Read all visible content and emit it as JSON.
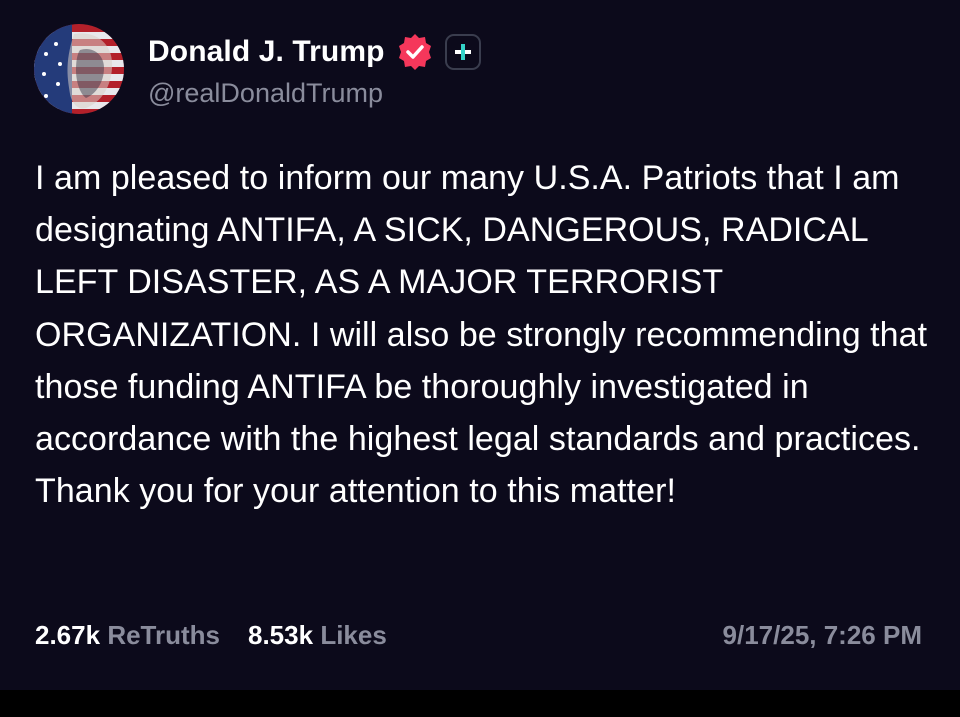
{
  "author": {
    "display_name": "Donald J. Trump",
    "handle": "@realDonaldTrump",
    "verified_icon": "verified-badge-icon",
    "plus_icon": "truth-plus-icon",
    "verified_color": "#f5375b",
    "plus_color": "#34d3c8"
  },
  "post": {
    "text": "I am pleased to inform our many U.S.A. Patriots that I am designating ANTIFA, A SICK, DANGEROUS, RADICAL LEFT DISASTER, AS A MAJOR TERRORIST ORGANIZATION. I will also be strongly recommending that those funding ANTIFA be thoroughly investigated in accordance with the highest legal standards and practices. Thank you for your attention to this matter!"
  },
  "stats": {
    "retruths_count": "2.67k",
    "retruths_label": "ReTruths",
    "likes_count": "8.53k",
    "likes_label": "Likes"
  },
  "timestamp": "9/17/25, 7:26 PM",
  "colors": {
    "background": "#0c0a1b",
    "text": "#ffffff",
    "muted": "#8a8c9c"
  }
}
